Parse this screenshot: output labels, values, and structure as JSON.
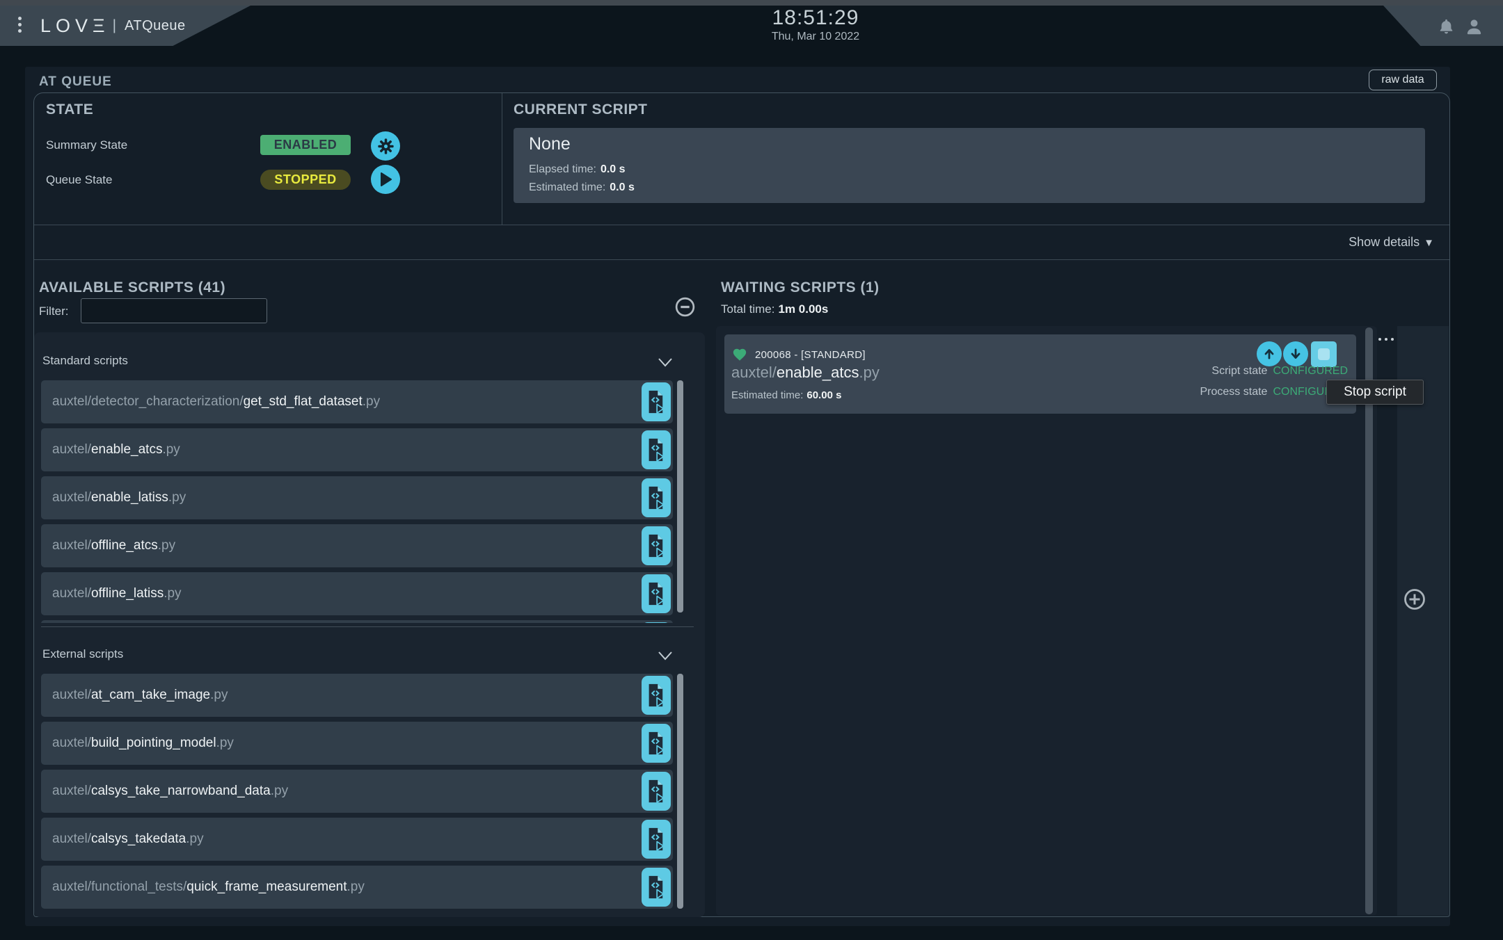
{
  "header": {
    "logo_text": "LOVΞ",
    "separator": "|",
    "app_title": "ATQueue",
    "time": "18:51:29",
    "date": "Thu, Mar 10 2022"
  },
  "panel": {
    "title": "AT QUEUE",
    "raw_data_button": "raw data",
    "show_details": "Show details",
    "show_details_arrow": "▼"
  },
  "state": {
    "section_title": "STATE",
    "summary_label": "Summary State",
    "summary_value": "ENABLED",
    "queue_label": "Queue State",
    "queue_value": "STOPPED"
  },
  "current_script": {
    "section_title": "CURRENT SCRIPT",
    "script_name": "None",
    "elapsed_label": "Elapsed time:",
    "elapsed_value": "0.0 s",
    "estimated_label": "Estimated time:",
    "estimated_value": "0.0 s"
  },
  "available_scripts": {
    "section_title": "AVAILABLE SCRIPTS (41)",
    "filter_label": "Filter:",
    "filter_value": "",
    "groups": [
      {
        "label": "Standard scripts",
        "items": [
          "auxtel/detector_characterization/get_std_flat_dataset.py",
          "auxtel/enable_atcs.py",
          "auxtel/enable_latiss.py",
          "auxtel/offline_atcs.py",
          "auxtel/offline_latiss.py"
        ]
      },
      {
        "label": "External scripts",
        "items": [
          "auxtel/at_cam_take_image.py",
          "auxtel/build_pointing_model.py",
          "auxtel/calsys_take_narrowband_data.py",
          "auxtel/calsys_takedata.py",
          "auxtel/functional_tests/quick_frame_measurement.py"
        ]
      }
    ]
  },
  "waiting_scripts": {
    "section_title": "WAITING SCRIPTS (1)",
    "total_time_label": "Total time:",
    "total_time_value": "1m 0.00s",
    "card": {
      "index_badge": "200068 - [STANDARD]",
      "script_path": "auxtel/enable_atcs.py",
      "estimated_label": "Estimated time:",
      "estimated_value": "60.00 s",
      "script_state_label": "Script state",
      "script_state_value": "CONFIGURED",
      "process_state_label": "Process state",
      "process_state_value": "CONFIGURED"
    },
    "tooltip": "Stop script"
  },
  "icons": [
    "kebab-menu-icon",
    "bell-icon",
    "user-icon",
    "gear-icon",
    "play-icon",
    "collapse-all-icon",
    "chevron-down-icon",
    "launch-script-icon",
    "heartbeat-icon",
    "move-up-icon",
    "move-down-icon",
    "stop-script-icon",
    "more-options-icon",
    "add-script-icon"
  ],
  "colors": {
    "accent_cyan": "#45c3e4",
    "enabled_bg": "#4cae73",
    "enabled_text": "#2b3945",
    "stopped_bg": "#4a4b21",
    "stopped_text": "#e9eb3e",
    "configured_green": "#3cab77",
    "heart_green": "#3cab77",
    "header_slate": "#3b4751",
    "panel_bg": "#141e28",
    "card_bg": "#3a4653",
    "row_bg": "#313e4a"
  }
}
